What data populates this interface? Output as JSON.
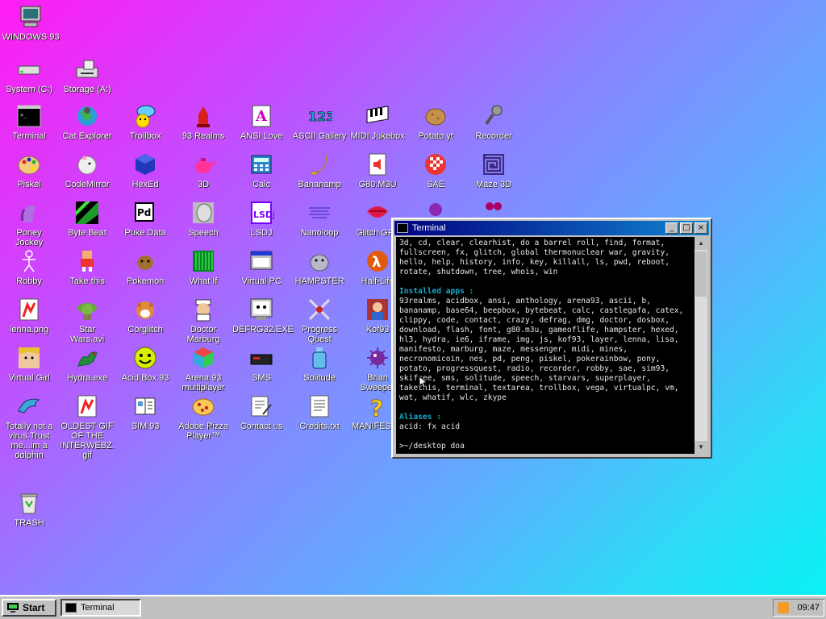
{
  "desktop": {
    "icons": [
      {
        "label": "WINDOWS 93",
        "icon": "computer-icon"
      },
      {
        "label": "System (C:)",
        "icon": "drive-icon"
      },
      {
        "label": "Storage (A:)",
        "icon": "floppy-drive-icon"
      },
      {
        "label": "Terminal",
        "icon": "terminal-icon"
      },
      {
        "label": "Cat Explorer",
        "icon": "cat-globe-icon"
      },
      {
        "label": "Trollbox",
        "icon": "chat-smiley-icon"
      },
      {
        "label": "93 Realms",
        "icon": "knight-icon"
      },
      {
        "label": "ANSI Love",
        "icon": "ansi-letter-icon"
      },
      {
        "label": "ASCII Gallery",
        "icon": "numbers-icon"
      },
      {
        "label": "MIDI Jukebox",
        "icon": "piano-icon"
      },
      {
        "label": "Potato.yt",
        "icon": "potato-icon"
      },
      {
        "label": "Recorder",
        "icon": "microphone-icon"
      },
      {
        "label": "Piskel",
        "icon": "palette-icon"
      },
      {
        "label": "CodeMirror",
        "icon": "unicorn-icon"
      },
      {
        "label": "HexEd",
        "icon": "cube-icon"
      },
      {
        "label": "3D",
        "icon": "teapot-icon"
      },
      {
        "label": "Calc",
        "icon": "calculator-icon"
      },
      {
        "label": "Bananamp",
        "icon": "banana-icon"
      },
      {
        "label": "G80.M3U",
        "icon": "audio-file-icon"
      },
      {
        "label": "SAE",
        "icon": "ball-icon"
      },
      {
        "label": "Maze 3D",
        "icon": "maze-icon"
      },
      {
        "label": "Poney\nJockey",
        "icon": "pony-icon"
      },
      {
        "label": "Byte Beat",
        "icon": "bytebeat-icon"
      },
      {
        "label": "Puke Data",
        "icon": "pd-icon"
      },
      {
        "label": "Speech",
        "icon": "face-icon"
      },
      {
        "label": "LSDJ",
        "icon": "lsdj-icon"
      },
      {
        "label": "Nanoloop",
        "icon": "wave-icon"
      },
      {
        "label": "Glitch GRL",
        "icon": "lips-icon"
      },
      {
        "label": "Robby",
        "icon": "stickman-icon"
      },
      {
        "label": "Take this",
        "icon": "pixel-man-icon"
      },
      {
        "label": "Pokemon",
        "icon": "pokemon-icon"
      },
      {
        "label": "What If",
        "icon": "matrix-icon"
      },
      {
        "label": "Virtual PC",
        "icon": "window-icon"
      },
      {
        "label": "HAMPSTER",
        "icon": "hamster-icon"
      },
      {
        "label": "Half-Life",
        "icon": "halflife-icon"
      },
      {
        "label": "lenna.png",
        "icon": "image-file-icon"
      },
      {
        "label": "Star\nWars.avi",
        "icon": "yoda-icon"
      },
      {
        "label": "Corglitch",
        "icon": "corgi-icon"
      },
      {
        "label": "Doctor\nMarburg",
        "icon": "doctor-icon"
      },
      {
        "label": "DEFRG32.EXE",
        "icon": "defrag-icon"
      },
      {
        "label": "Progress\nQuest",
        "icon": "swords-icon"
      },
      {
        "label": "Kof93",
        "icon": "fighter-icon"
      },
      {
        "label": "Virtual Girl",
        "icon": "girl-icon"
      },
      {
        "label": "Hydra.exe",
        "icon": "hydra-icon"
      },
      {
        "label": "Acid Box 93",
        "icon": "acid-smiley-icon"
      },
      {
        "label": "Arena 93\nmultiplayer",
        "icon": "arena-cube-icon"
      },
      {
        "label": "SMS",
        "icon": "console-icon"
      },
      {
        "label": "Solitude",
        "icon": "bottle-icon"
      },
      {
        "label": "Brian\nSweeper",
        "icon": "mine-icon"
      },
      {
        "label": "Totally not a\nvirus.Trust\nme...im a\ndolphin",
        "icon": "dolphin-icon"
      },
      {
        "label": "OLDEST GIF\nOF THE\nINTERWEBZ.\ngif",
        "icon": "gif-file-icon"
      },
      {
        "label": "SIM 93",
        "icon": "book-icon"
      },
      {
        "label": "Adobe Pizza\nPlayer™",
        "icon": "pizza-icon"
      },
      {
        "label": "Contact us",
        "icon": "mail-icon"
      },
      {
        "label": "Credits.txt",
        "icon": "text-file-icon"
      },
      {
        "label": "MANIFESTO",
        "icon": "question-icon"
      },
      {
        "label": "TRASH",
        "icon": "trash-icon"
      }
    ],
    "hidden_icons": [
      {
        "icon": "virus-icon"
      },
      {
        "icon": "people-icon"
      }
    ]
  },
  "terminal": {
    "title": "Terminal",
    "commands_text": "3d, cd, clear, clearhist, do a barrel roll, find, format, fullscreen, fx, glitch, global thermonuclear war, gravity, hello, help, history, info, key, killall, ls, pwd, reboot, rotate, shutdown, tree, whois, win",
    "installed_heading": "Installed apps :",
    "installed_text": "93realms, acidbox, ansi, anthology, arena93, ascii, b, bananamp, base64, beepbox, bytebeat, calc, castlegafa, catex, clippy, code, contact, crazy, defrag, dmg, doctor, dosbox, download, flash, font, g80.m3u, gameoflife, hampster, hexed, hl3, hydra, ie6, iframe, img, js, kof93, layer, lenna, lisa, manifesto, marburg, maze, messenger, midi, mines, necronomicoin, nes, pd, peng, piskel, pokerainbow, pony, potato, progressquest, radio, recorder, robby, sae, sim93, skifree, sms, solitude, speech, starvars, superplayer, takethis, terminal, textarea, trollbox, vega, virtualpc, vm, wat, whatif, wlc, zkype",
    "aliases_heading": "Aliases :",
    "aliases_text": "acid: fx acid",
    "prompt": ">~/desktop doa",
    "btn_min": "_",
    "btn_max": "□",
    "btn_close": "×"
  },
  "taskbar": {
    "start_label": "Start",
    "task_label": "Terminal",
    "clock": "09:47"
  }
}
